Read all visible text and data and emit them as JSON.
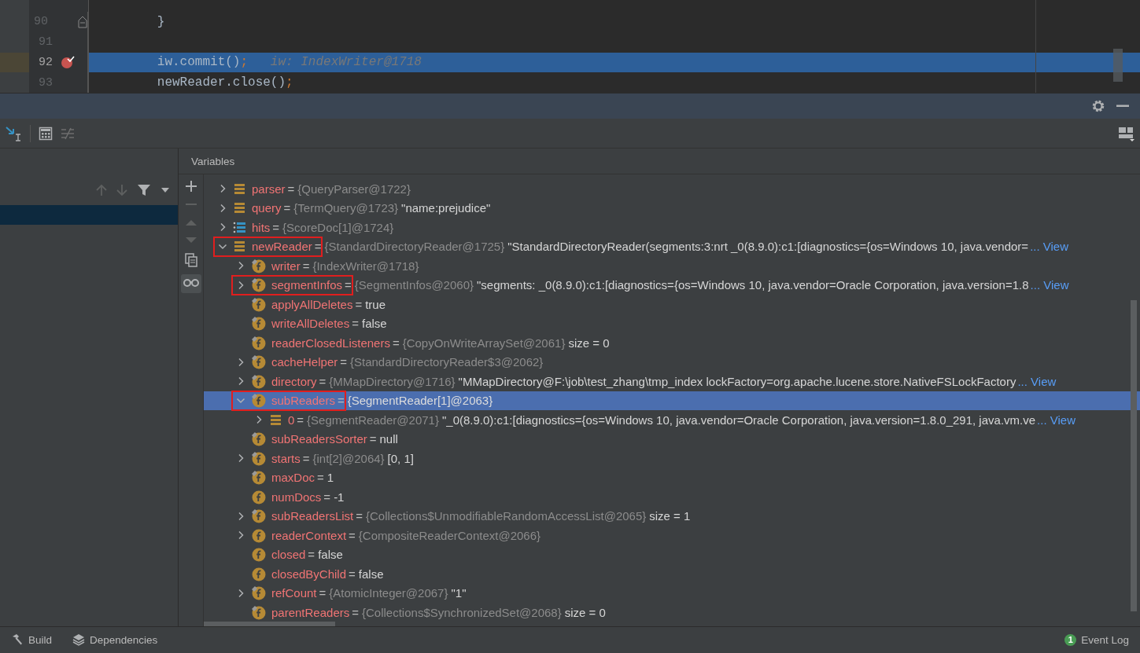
{
  "editor": {
    "lines": [
      {
        "number": "90",
        "tokens": [
          {
            "text": "        }",
            "kind": "plain"
          }
        ],
        "selected": false,
        "breakpoint": false,
        "fold": true
      },
      {
        "number": "91",
        "selected": false,
        "breakpoint": false,
        "fold": false
      },
      {
        "number": "92",
        "tokens": [
          {
            "text": "        iw.commit()",
            "kind": "plain"
          },
          {
            "text": ";",
            "kind": "punct"
          },
          {
            "text": "   iw: IndexWriter@1718",
            "kind": "hint"
          }
        ],
        "selected": true,
        "breakpoint": true,
        "fold": false
      },
      {
        "number": "93",
        "tokens": [
          {
            "text": "        newReader.close()",
            "kind": "plain"
          },
          {
            "text": ";",
            "kind": "punct"
          }
        ],
        "selected": false,
        "breakpoint": false,
        "fold": false
      }
    ]
  },
  "variables": {
    "title": "Variables",
    "rows": [
      {
        "kind": "object",
        "name": "parser",
        "op": "=",
        "type": "{QueryParser@1722}",
        "expandable": true,
        "expanded": false,
        "selected": false,
        "annotated": false
      },
      {
        "kind": "object",
        "name": "query",
        "op": "=",
        "type": "{TermQuery@1723}",
        "value": "\"name:prejudice\"",
        "expandable": true,
        "expanded": false,
        "selected": false,
        "annotated": false
      },
      {
        "kind": "array",
        "name": "hits",
        "op": "=",
        "type": "{ScoreDoc[1]@1724}",
        "expandable": true,
        "expanded": false,
        "selected": false,
        "annotated": false
      },
      {
        "kind": "object",
        "name": "newReader",
        "op": "=",
        "type": "{StandardDirectoryReader@1725}",
        "value": "\"StandardDirectoryReader(segments:3:nrt _0(8.9.0):c1:[diagnostics={os=Windows 10, java.vendor=",
        "link": "... View",
        "expandable": true,
        "expanded": true,
        "selected": false,
        "annotated": true,
        "children": [
          {
            "kind": "field",
            "final": true,
            "name": "writer",
            "op": "=",
            "type": "{IndexWriter@1718}",
            "expandable": true,
            "expanded": false,
            "selected": false,
            "annotated": false
          },
          {
            "kind": "field",
            "final": true,
            "name": "segmentInfos",
            "op": "=",
            "type": "{SegmentInfos@2060}",
            "value": "\"segments: _0(8.9.0):c1:[diagnostics={os=Windows 10, java.vendor=Oracle Corporation, java.version=1.8",
            "link": "... View",
            "expandable": true,
            "expanded": false,
            "selected": false,
            "annotated": true
          },
          {
            "kind": "field",
            "final": true,
            "name": "applyAllDeletes",
            "op": "=",
            "value": "true",
            "expandable": false,
            "selected": false,
            "annotated": false
          },
          {
            "kind": "field",
            "final": true,
            "name": "writeAllDeletes",
            "op": "=",
            "value": "false",
            "expandable": false,
            "selected": false,
            "annotated": false
          },
          {
            "kind": "field",
            "final": true,
            "name": "readerClosedListeners",
            "op": "=",
            "type": "{CopyOnWriteArraySet@2061}",
            "value": " size = 0",
            "expandable": false,
            "selected": false,
            "annotated": false
          },
          {
            "kind": "field",
            "final": true,
            "name": "cacheHelper",
            "op": "=",
            "type": "{StandardDirectoryReader$3@2062}",
            "expandable": true,
            "expanded": false,
            "selected": false,
            "annotated": false
          },
          {
            "kind": "field",
            "final": true,
            "name": "directory",
            "op": "=",
            "type": "{MMapDirectory@1716}",
            "value": "\"MMapDirectory@F:\\job\\test_zhang\\tmp_index lockFactory=org.apache.lucene.store.NativeFSLockFactory",
            "link": "... View",
            "expandable": true,
            "expanded": false,
            "selected": false,
            "annotated": false
          },
          {
            "kind": "field",
            "final": true,
            "name": "subReaders",
            "op": "=",
            "type": "{SegmentReader[1]@2063}",
            "expandable": true,
            "expanded": true,
            "selected": true,
            "annotated": true,
            "children": [
              {
                "kind": "object",
                "name": "0",
                "op": "=",
                "type": "{SegmentReader@2071}",
                "value": "\"_0(8.9.0):c1:[diagnostics={os=Windows 10, java.vendor=Oracle Corporation, java.version=1.8.0_291, java.vm.ve",
                "link": "... View",
                "expandable": true,
                "expanded": false,
                "selected": false,
                "annotated": false
              }
            ]
          },
          {
            "kind": "field",
            "final": true,
            "name": "subReadersSorter",
            "op": "=",
            "value": "null",
            "expandable": false,
            "selected": false,
            "annotated": false
          },
          {
            "kind": "field",
            "final": true,
            "name": "starts",
            "op": "=",
            "type": "{int[2]@2064}",
            "value": "[0, 1]",
            "expandable": true,
            "expanded": false,
            "selected": false,
            "annotated": false
          },
          {
            "kind": "field",
            "final": true,
            "name": "maxDoc",
            "op": "=",
            "value": "1",
            "expandable": false,
            "selected": false,
            "annotated": false
          },
          {
            "kind": "field",
            "final": false,
            "name": "numDocs",
            "op": "=",
            "value": "-1",
            "expandable": false,
            "selected": false,
            "annotated": false
          },
          {
            "kind": "field",
            "final": true,
            "name": "subReadersList",
            "op": "=",
            "type": "{Collections$UnmodifiableRandomAccessList@2065}",
            "value": " size = 1",
            "expandable": true,
            "expanded": false,
            "selected": false,
            "annotated": false
          },
          {
            "kind": "field",
            "final": false,
            "name": "readerContext",
            "op": "=",
            "type": "{CompositeReaderContext@2066}",
            "expandable": true,
            "expanded": false,
            "selected": false,
            "annotated": false
          },
          {
            "kind": "field",
            "final": false,
            "name": "closed",
            "op": "=",
            "value": "false",
            "expandable": false,
            "selected": false,
            "annotated": false
          },
          {
            "kind": "field",
            "final": false,
            "name": "closedByChild",
            "op": "=",
            "value": "false",
            "expandable": false,
            "selected": false,
            "annotated": false
          },
          {
            "kind": "field",
            "final": true,
            "name": "refCount",
            "op": "=",
            "type": "{AtomicInteger@2067}",
            "value": "\"1\"",
            "expandable": true,
            "expanded": false,
            "selected": false,
            "annotated": false
          },
          {
            "kind": "field",
            "final": true,
            "name": "parentReaders",
            "op": "=",
            "type": "{Collections$SynchronizedSet@2068}",
            "value": " size = 0",
            "expandable": false,
            "selected": false,
            "annotated": false
          }
        ]
      }
    ]
  },
  "frames": {
    "rows": [
      {
        "selected": true
      }
    ]
  },
  "status_bar": {
    "tabs": [
      {
        "label": "Build",
        "kind": "build"
      },
      {
        "label": "Dependencies",
        "kind": "dependencies"
      }
    ],
    "event_log": {
      "label": "Event Log",
      "count": "1"
    }
  }
}
